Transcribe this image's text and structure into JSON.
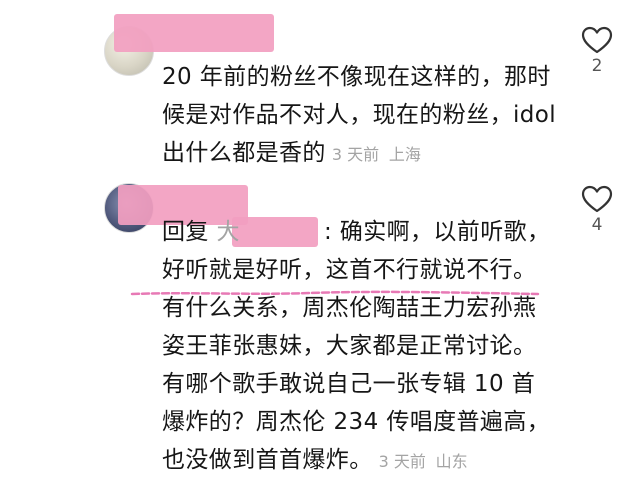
{
  "comments": [
    {
      "text": "20 年前的粉丝不像现在这样的，那时候是对作品不对人，现在的粉丝，idol 出什么都是香的",
      "time": "3 天前",
      "location": "上海",
      "likes": "2"
    },
    {
      "reply_prefix": "回复",
      "reply_target_visible": "大",
      "reply_text": ": 确实啊，以前听歌，好听就是好听，这首不行就说不行。有什么关系，周杰伦陶喆王力宏孙燕姿王菲张惠妹，大家都是正常讨论。有哪个歌手敢说自己一张专辑 10 首爆炸的？周杰伦 234 传唱度普遍高，也没做到首首爆炸。",
      "time": "3 天前",
      "location": "山东",
      "likes": "4"
    }
  ],
  "colors": {
    "redaction": "#f29ec0",
    "meta_gray": "#a4a4a4",
    "text": "#161616",
    "underline_pink": "#e779b5"
  },
  "icons": {
    "like": "heart-outline-icon"
  }
}
